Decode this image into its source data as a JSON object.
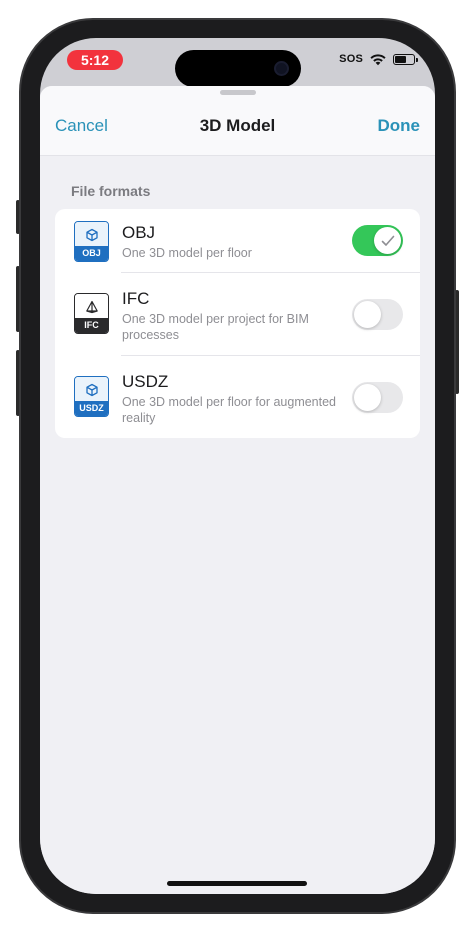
{
  "status_bar": {
    "time": "5:12",
    "sos": "SOS",
    "time_pill_color": "#f2333d"
  },
  "navbar": {
    "cancel_label": "Cancel",
    "title": "3D Model",
    "done_label": "Done",
    "accent_color": "#2a92b8"
  },
  "section": {
    "header": "File formats"
  },
  "formats": [
    {
      "icon_label": "OBJ",
      "icon": "cube-icon",
      "title": "OBJ",
      "subtitle": "One 3D model per floor",
      "enabled": true
    },
    {
      "icon_label": "IFC",
      "icon": "prism-icon",
      "title": "IFC",
      "subtitle": "One 3D model per project for BIM processes",
      "enabled": false
    },
    {
      "icon_label": "USDZ",
      "icon": "cube-icon",
      "title": "USDZ",
      "subtitle": "One 3D model per floor for augmented reality",
      "enabled": false
    }
  ],
  "toggle_on_color": "#34c759"
}
